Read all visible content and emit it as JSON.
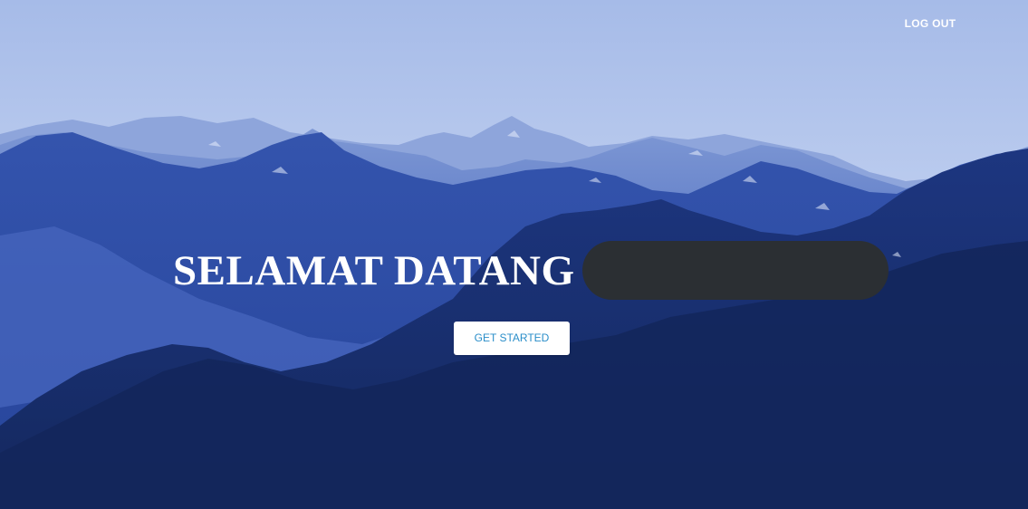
{
  "nav": {
    "logout_label": "LOG OUT"
  },
  "hero": {
    "welcome_text": "SELAMAT DATANG",
    "username": "",
    "cta_label": "GET STARTED"
  },
  "colors": {
    "sky_top": "#a9bde9",
    "sky_bottom": "#c9d6f1",
    "mountain_far": "#7f97d6",
    "mountain_mid": "#2f4ea6",
    "mountain_near": "#182f72",
    "redaction_pill": "#2b2f33",
    "cta_text": "#2a8ec9"
  }
}
